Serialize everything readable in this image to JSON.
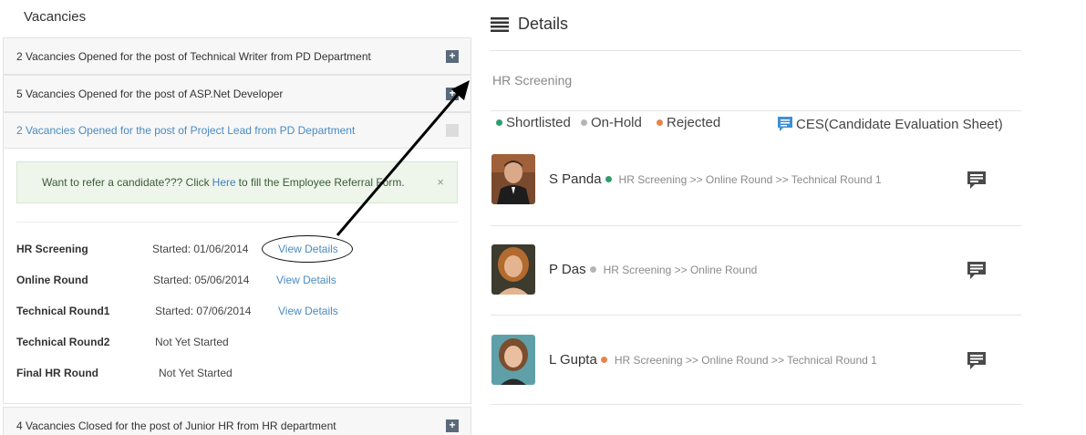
{
  "left": {
    "title": "Vacancies",
    "panels": [
      {
        "label": "2 Vacancies Opened for the post of Technical Writer from PD Department",
        "toggle": "+"
      },
      {
        "label": "5 Vacancies Opened for the post of ASP.Net Developer",
        "toggle": "+"
      },
      {
        "label": "2 Vacancies Opened for the post of Project Lead from PD Department",
        "toggle": ""
      },
      {
        "label": "4 Vacancies Closed for the post of Junior HR from HR department",
        "toggle": "+"
      }
    ],
    "alert": {
      "before": "Want to refer a candidate??? Click",
      "link": "Here",
      "after": "to fill the Employee Referral Form.",
      "close": "×"
    },
    "rounds": [
      {
        "name": "HR Screening",
        "status": "Started: 01/06/2014",
        "link": "View Details"
      },
      {
        "name": "Online Round",
        "status": "Started: 05/06/2014",
        "link": "View Details"
      },
      {
        "name": "Technical Round1",
        "status": "Started: 07/06/2014",
        "link": "View Details"
      },
      {
        "name": "Technical Round2",
        "status": "Not Yet Started",
        "link": ""
      },
      {
        "name": "Final HR Round",
        "status": "Not Yet Started",
        "link": ""
      }
    ]
  },
  "details": {
    "title": "Details",
    "section_title": "HR Screening",
    "legend": [
      {
        "label": "Shortlisted",
        "color": "#2e9e6b"
      },
      {
        "label": "On-Hold",
        "color": "#b5b5b5"
      },
      {
        "label": "Rejected",
        "color": "#e8834a"
      },
      {
        "label": "CES(Candidate Evaluation Sheet)",
        "icon": "comment-icon",
        "color": "#3d8fd6"
      }
    ],
    "candidates": [
      {
        "name": "S Panda",
        "status_color": "#2e9e6b",
        "path": "HR Screening >> Online Round >> Technical Round 1"
      },
      {
        "name": "P Das",
        "status_color": "#b5b5b5",
        "path": "HR Screening >> Online Round"
      },
      {
        "name": "L Gupta",
        "status_color": "#e8834a",
        "path": "HR Screening >> Online Round >> Technical Round 1"
      }
    ]
  }
}
